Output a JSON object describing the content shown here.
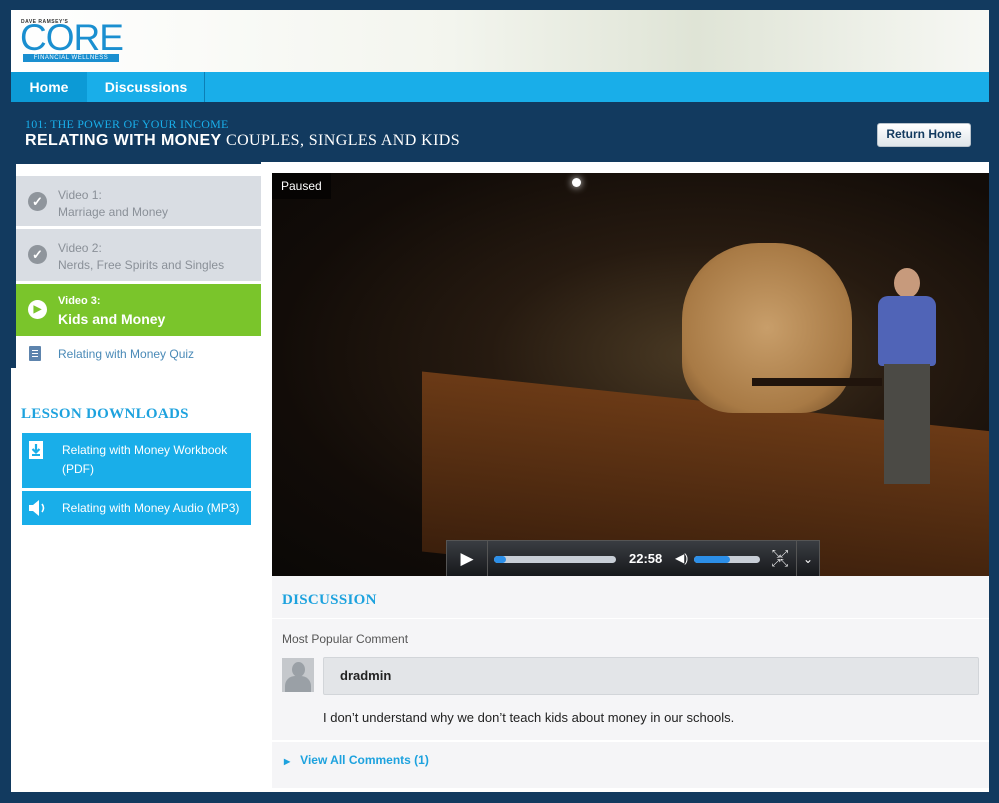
{
  "brand": {
    "tagline": "DAVE RAMSEY'S",
    "name": "CORE",
    "subtitle": "FINANCIAL WELLNESS"
  },
  "nav": {
    "items": [
      {
        "label": "Home"
      },
      {
        "label": "Discussions"
      }
    ]
  },
  "header": {
    "lesson": "101: THE POWER OF YOUR INCOME",
    "title_bold": "RELATING WITH MONEY",
    "title_rest": "COUPLES, SINGLES AND KIDS",
    "return_button": "Return Home"
  },
  "videos": [
    {
      "label": "Video 1:",
      "title": "Marriage and Money",
      "state": "complete"
    },
    {
      "label": "Video 2:",
      "title": "Nerds, Free Spirits and Singles",
      "state": "complete"
    },
    {
      "label": "Video 3:",
      "title": "Kids and Money",
      "state": "current"
    }
  ],
  "quiz": {
    "label": "Relating with Money Quiz"
  },
  "downloads": {
    "title": "LESSON DOWNLOADS",
    "items": [
      {
        "label": "Relating with Money Workbook (PDF)",
        "icon": "download-icon"
      },
      {
        "label": "Relating with Money Audio (MP3)",
        "icon": "speaker-icon"
      }
    ]
  },
  "player": {
    "status": "Paused",
    "timecode": "22:58",
    "progress": 0.1,
    "volume": 0.55,
    "accent": "#2c8fe8"
  },
  "discussion": {
    "title": "DISCUSSION",
    "most_popular_label": "Most Popular Comment",
    "username": "dradmin",
    "comment": "I don’t understand why we don’t teach kids about money in our schools.",
    "view_all": "View All Comments (1)"
  },
  "colors": {
    "navy": "#123a5f",
    "cyan": "#19aee9",
    "green": "#7ac52b"
  }
}
